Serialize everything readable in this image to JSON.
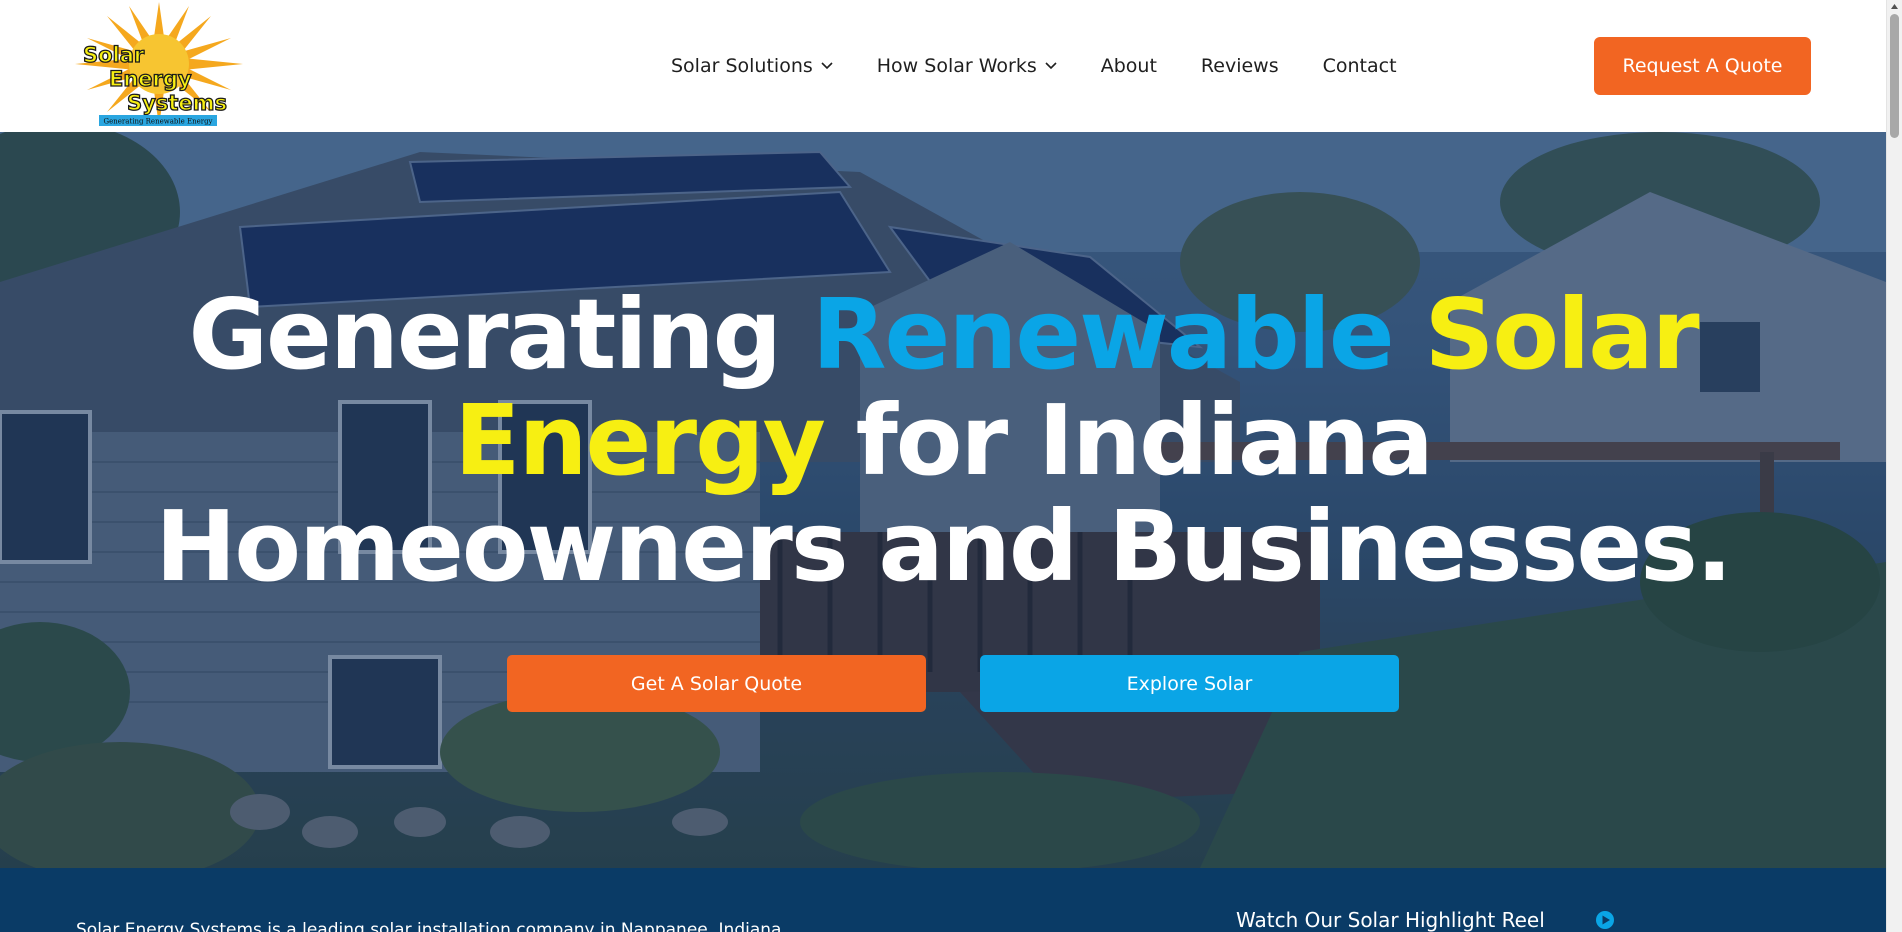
{
  "header": {
    "logo": {
      "line1": "Solar",
      "line2": "Energy",
      "line3": "Systems",
      "tagline": "Generating Renewable Energy"
    },
    "nav": [
      {
        "label": "Solar Solutions",
        "dropdown": true
      },
      {
        "label": "How Solar Works",
        "dropdown": true
      },
      {
        "label": "About",
        "dropdown": false
      },
      {
        "label": "Reviews",
        "dropdown": false
      },
      {
        "label": "Contact",
        "dropdown": false
      }
    ],
    "cta_label": "Request A Quote"
  },
  "hero": {
    "headline_parts": {
      "p1": "Generating ",
      "p2": "Renewable",
      "p3": " ",
      "p4": "Solar",
      "p5": "Energy",
      "p6": " for Indiana",
      "p7": "Homeowners and Businesses."
    },
    "primary_button": "Get A Solar Quote",
    "secondary_button": "Explore Solar"
  },
  "intro": {
    "text": "Solar Energy Systems is a leading solar installation company in Nappanee, Indiana",
    "reel_label": "Watch Our Solar Highlight Reel"
  },
  "colors": {
    "accent_orange": "#f26522",
    "accent_blue": "#0aa5e6",
    "accent_yellow": "#f7ef12",
    "navy": "#0a3b66"
  },
  "icons": {
    "dropdown": "chevron-down-icon",
    "play": "play-circle-icon"
  }
}
